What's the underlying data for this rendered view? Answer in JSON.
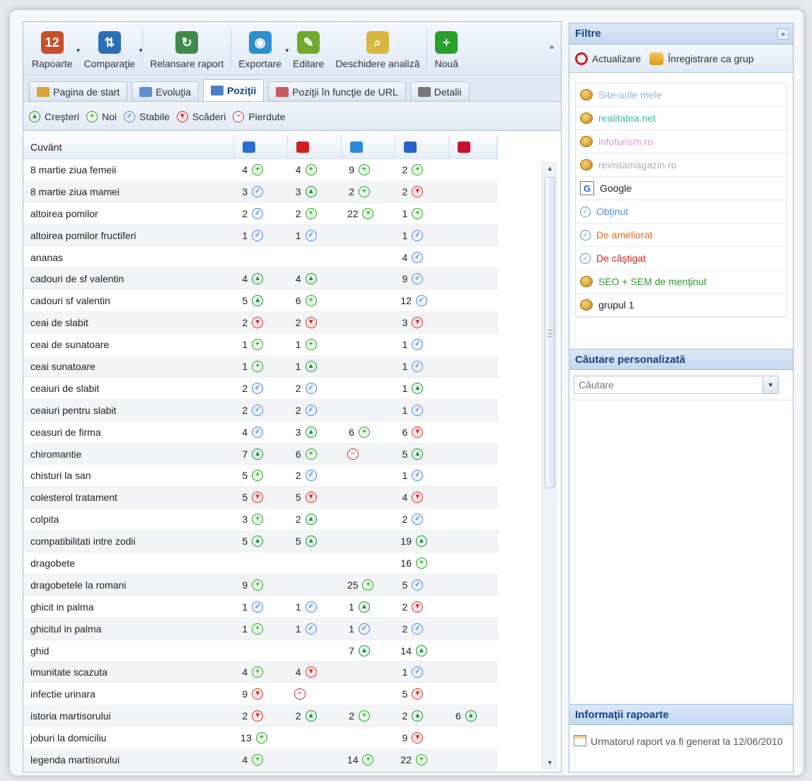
{
  "toolbar": {
    "items": [
      {
        "label": "Rapoarte",
        "icon": "calendar-icon",
        "color": "#c94f2a",
        "glyph": "12",
        "dropdown": true
      },
      {
        "label": "Comparaţie",
        "icon": "compare-icon",
        "color": "#2c6fb5",
        "glyph": "⇅",
        "dropdown": true
      },
      {
        "label": "Relansare raport",
        "icon": "refresh-report-icon",
        "color": "#3f8a4a",
        "glyph": "↻",
        "dropdown": false
      },
      {
        "label": "Exportare",
        "icon": "export-globe-icon",
        "color": "#2e8fcf",
        "glyph": "◉",
        "dropdown": true
      },
      {
        "label": "Editare",
        "icon": "pencil-icon",
        "color": "#6faa2b",
        "glyph": "✎",
        "dropdown": false
      },
      {
        "label": "Deschidere analiză",
        "icon": "open-analysis-icon",
        "color": "#d8b640",
        "glyph": "⌕",
        "dropdown": false
      },
      {
        "label": "Nouă",
        "icon": "new-plus-icon",
        "color": "#2aa02a",
        "glyph": "+",
        "dropdown": false
      }
    ],
    "more": "»"
  },
  "tabs": [
    {
      "label": "Pagina de start",
      "icon": "home-icon",
      "color": "#d9a43a",
      "active": false
    },
    {
      "label": "Evoluţia",
      "icon": "evolution-chart-icon",
      "color": "#5f8fcf",
      "active": false
    },
    {
      "label": "Poziţii",
      "icon": "positions-icon",
      "color": "#4f7fc0",
      "active": true
    },
    {
      "label": "Poziţii în funcţie de URL",
      "icon": "url-positions-icon",
      "color": "#c85a5a",
      "active": false
    },
    {
      "label": "Detalii",
      "icon": "details-icon",
      "color": "#777777",
      "active": false
    }
  ],
  "legend": [
    {
      "label": "Creşteri",
      "type": "crestere"
    },
    {
      "label": "Noi",
      "type": "nou"
    },
    {
      "label": "Stabile",
      "type": "stabil"
    },
    {
      "label": "Scăderi",
      "type": "scadere"
    },
    {
      "label": "Pierdute",
      "type": "pierdut"
    }
  ],
  "grid": {
    "column_word": "Cuvânt",
    "engines": [
      {
        "icon": "engine-flag-icon",
        "color": "#2a6fcf"
      },
      {
        "icon": "engine-red-icon",
        "color": "#d02020"
      },
      {
        "icon": "engine-bing-icon",
        "color": "#2b8ad9"
      },
      {
        "icon": "engine-google-icon",
        "color": "#2a62c9"
      },
      {
        "icon": "engine-yahoo-icon",
        "color": "#c8102e"
      }
    ],
    "rows": [
      {
        "word": "8 martie ziua femeii",
        "c": [
          [
            "4",
            "nou"
          ],
          [
            "4",
            "nou"
          ],
          [
            "9",
            "nou"
          ],
          [
            "2",
            "nou"
          ],
          null
        ]
      },
      {
        "word": "8 martie ziua mamei",
        "c": [
          [
            "3",
            "stabil"
          ],
          [
            "3",
            "crestere"
          ],
          [
            "2",
            "nou"
          ],
          [
            "2",
            "scadere"
          ],
          null
        ]
      },
      {
        "word": "altoirea pomilor",
        "c": [
          [
            "2",
            "stabil"
          ],
          [
            "2",
            "nou"
          ],
          [
            "22",
            "nou"
          ],
          [
            "1",
            "nou"
          ],
          null
        ]
      },
      {
        "word": "altoirea pomilor fructiferi",
        "c": [
          [
            "1",
            "stabil"
          ],
          [
            "1",
            "stabil"
          ],
          null,
          [
            "1",
            "stabil"
          ],
          null
        ]
      },
      {
        "word": "ananas",
        "c": [
          null,
          null,
          null,
          [
            "4",
            "stabil"
          ],
          null
        ]
      },
      {
        "word": "cadouri de sf valentin",
        "c": [
          [
            "4",
            "crestere"
          ],
          [
            "4",
            "crestere"
          ],
          null,
          [
            "9",
            "stabil"
          ],
          null
        ]
      },
      {
        "word": "cadouri sf valentin",
        "c": [
          [
            "5",
            "crestere"
          ],
          [
            "6",
            "nou"
          ],
          null,
          [
            "12",
            "stabil"
          ],
          null
        ]
      },
      {
        "word": "ceai de slabit",
        "c": [
          [
            "2",
            "scadere"
          ],
          [
            "2",
            "scadere"
          ],
          null,
          [
            "3",
            "scadere"
          ],
          null
        ]
      },
      {
        "word": "ceai de sunatoare",
        "c": [
          [
            "1",
            "nou"
          ],
          [
            "1",
            "nou"
          ],
          null,
          [
            "1",
            "stabil"
          ],
          null
        ]
      },
      {
        "word": "ceai sunatoare",
        "c": [
          [
            "1",
            "nou"
          ],
          [
            "1",
            "crestere"
          ],
          null,
          [
            "1",
            "stabil"
          ],
          null
        ]
      },
      {
        "word": "ceaiuri de slabit",
        "c": [
          [
            "2",
            "stabil"
          ],
          [
            "2",
            "stabil"
          ],
          null,
          [
            "1",
            "crestere"
          ],
          null
        ]
      },
      {
        "word": "ceaiuri pentru slabit",
        "c": [
          [
            "2",
            "stabil"
          ],
          [
            "2",
            "stabil"
          ],
          null,
          [
            "1",
            "stabil"
          ],
          null
        ]
      },
      {
        "word": "ceasuri de firma",
        "c": [
          [
            "4",
            "stabil"
          ],
          [
            "3",
            "crestere"
          ],
          [
            "6",
            "nou"
          ],
          [
            "6",
            "scadere"
          ],
          null
        ]
      },
      {
        "word": "chiromantie",
        "c": [
          [
            "7",
            "crestere"
          ],
          [
            "6",
            "nou"
          ],
          [
            "",
            "pierdut"
          ],
          [
            "5",
            "crestere"
          ],
          null
        ]
      },
      {
        "word": "chisturi la san",
        "c": [
          [
            "5",
            "nou"
          ],
          [
            "2",
            "stabil"
          ],
          null,
          [
            "1",
            "stabil"
          ],
          null
        ]
      },
      {
        "word": "colesterol tratament",
        "c": [
          [
            "5",
            "scadere"
          ],
          [
            "5",
            "scadere"
          ],
          null,
          [
            "4",
            "scadere"
          ],
          null
        ]
      },
      {
        "word": "colpita",
        "c": [
          [
            "3",
            "nou"
          ],
          [
            "2",
            "crestere"
          ],
          null,
          [
            "2",
            "stabil"
          ],
          null
        ]
      },
      {
        "word": "compatibilitati intre zodii",
        "c": [
          [
            "5",
            "crestere"
          ],
          [
            "5",
            "crestere"
          ],
          null,
          [
            "19",
            "crestere"
          ],
          null
        ]
      },
      {
        "word": "dragobete",
        "c": [
          null,
          null,
          null,
          [
            "16",
            "nou"
          ],
          null
        ]
      },
      {
        "word": "dragobetele la romani",
        "c": [
          [
            "9",
            "nou"
          ],
          null,
          [
            "25",
            "nou"
          ],
          [
            "5",
            "stabil"
          ],
          null
        ]
      },
      {
        "word": "ghicit in palma",
        "c": [
          [
            "1",
            "stabil"
          ],
          [
            "1",
            "stabil"
          ],
          [
            "1",
            "crestere"
          ],
          [
            "2",
            "scadere"
          ],
          null
        ]
      },
      {
        "word": "ghicitul in palma",
        "c": [
          [
            "1",
            "nou"
          ],
          [
            "1",
            "stabil"
          ],
          [
            "1",
            "stabil"
          ],
          [
            "2",
            "stabil"
          ],
          null
        ]
      },
      {
        "word": "ghid",
        "c": [
          null,
          null,
          [
            "7",
            "crestere"
          ],
          [
            "14",
            "crestere"
          ],
          null
        ]
      },
      {
        "word": "imunitate scazuta",
        "c": [
          [
            "4",
            "nou"
          ],
          [
            "4",
            "scadere"
          ],
          null,
          [
            "1",
            "stabil"
          ],
          null
        ]
      },
      {
        "word": "infectie urinara",
        "c": [
          [
            "9",
            "scadere"
          ],
          [
            "",
            "pierdut"
          ],
          null,
          [
            "5",
            "scadere"
          ],
          null
        ]
      },
      {
        "word": "istoria martisorului",
        "c": [
          [
            "2",
            "scadere"
          ],
          [
            "2",
            "crestere"
          ],
          [
            "2",
            "nou"
          ],
          [
            "2",
            "crestere"
          ],
          [
            "6",
            "crestere"
          ]
        ]
      },
      {
        "word": "joburi la domiciliu",
        "c": [
          [
            "13",
            "nou"
          ],
          null,
          null,
          [
            "9",
            "scadere"
          ],
          null
        ]
      },
      {
        "word": "legenda martisorului",
        "c": [
          [
            "4",
            "nou"
          ],
          null,
          [
            "14",
            "nou"
          ],
          [
            "22",
            "nou"
          ],
          null
        ]
      }
    ]
  },
  "filters": {
    "title": "Filtre",
    "collapse": "»",
    "actions": [
      {
        "label": "Actualizare",
        "icon": "refresh-icon"
      },
      {
        "label": "Înregistrare ca grup",
        "icon": "save-group-icon"
      }
    ],
    "items": [
      {
        "label": "Site-urile mele",
        "type": "coin",
        "color": "#8fb3e8"
      },
      {
        "label": "realitatea.net",
        "type": "coin",
        "color": "#35b8a8"
      },
      {
        "label": "infoturism.ro",
        "type": "coin",
        "color": "#d89ad4"
      },
      {
        "label": "revistamagazin.ro",
        "type": "coin",
        "color": "#9fb0c8"
      },
      {
        "label": "Google",
        "type": "google",
        "color": "#222222"
      },
      {
        "label": "Obţinut",
        "type": "check",
        "color": "#5b8fd4"
      },
      {
        "label": "De ameliorat",
        "type": "check",
        "color": "#e06a1a"
      },
      {
        "label": "De câştigat",
        "type": "check",
        "color": "#d81e1e"
      },
      {
        "label": "SEO + SEM de menţinut",
        "type": "coin",
        "color": "#2a9a2a"
      },
      {
        "label": "grupul 1",
        "type": "coin",
        "color": "#222222"
      }
    ]
  },
  "custom_search": {
    "title": "Căutare personalizată",
    "placeholder": "Căutare"
  },
  "report_info": {
    "title": "Informaţii rapoarte",
    "text": "Urmatorul raport va fi generat la 12/06/2010"
  }
}
